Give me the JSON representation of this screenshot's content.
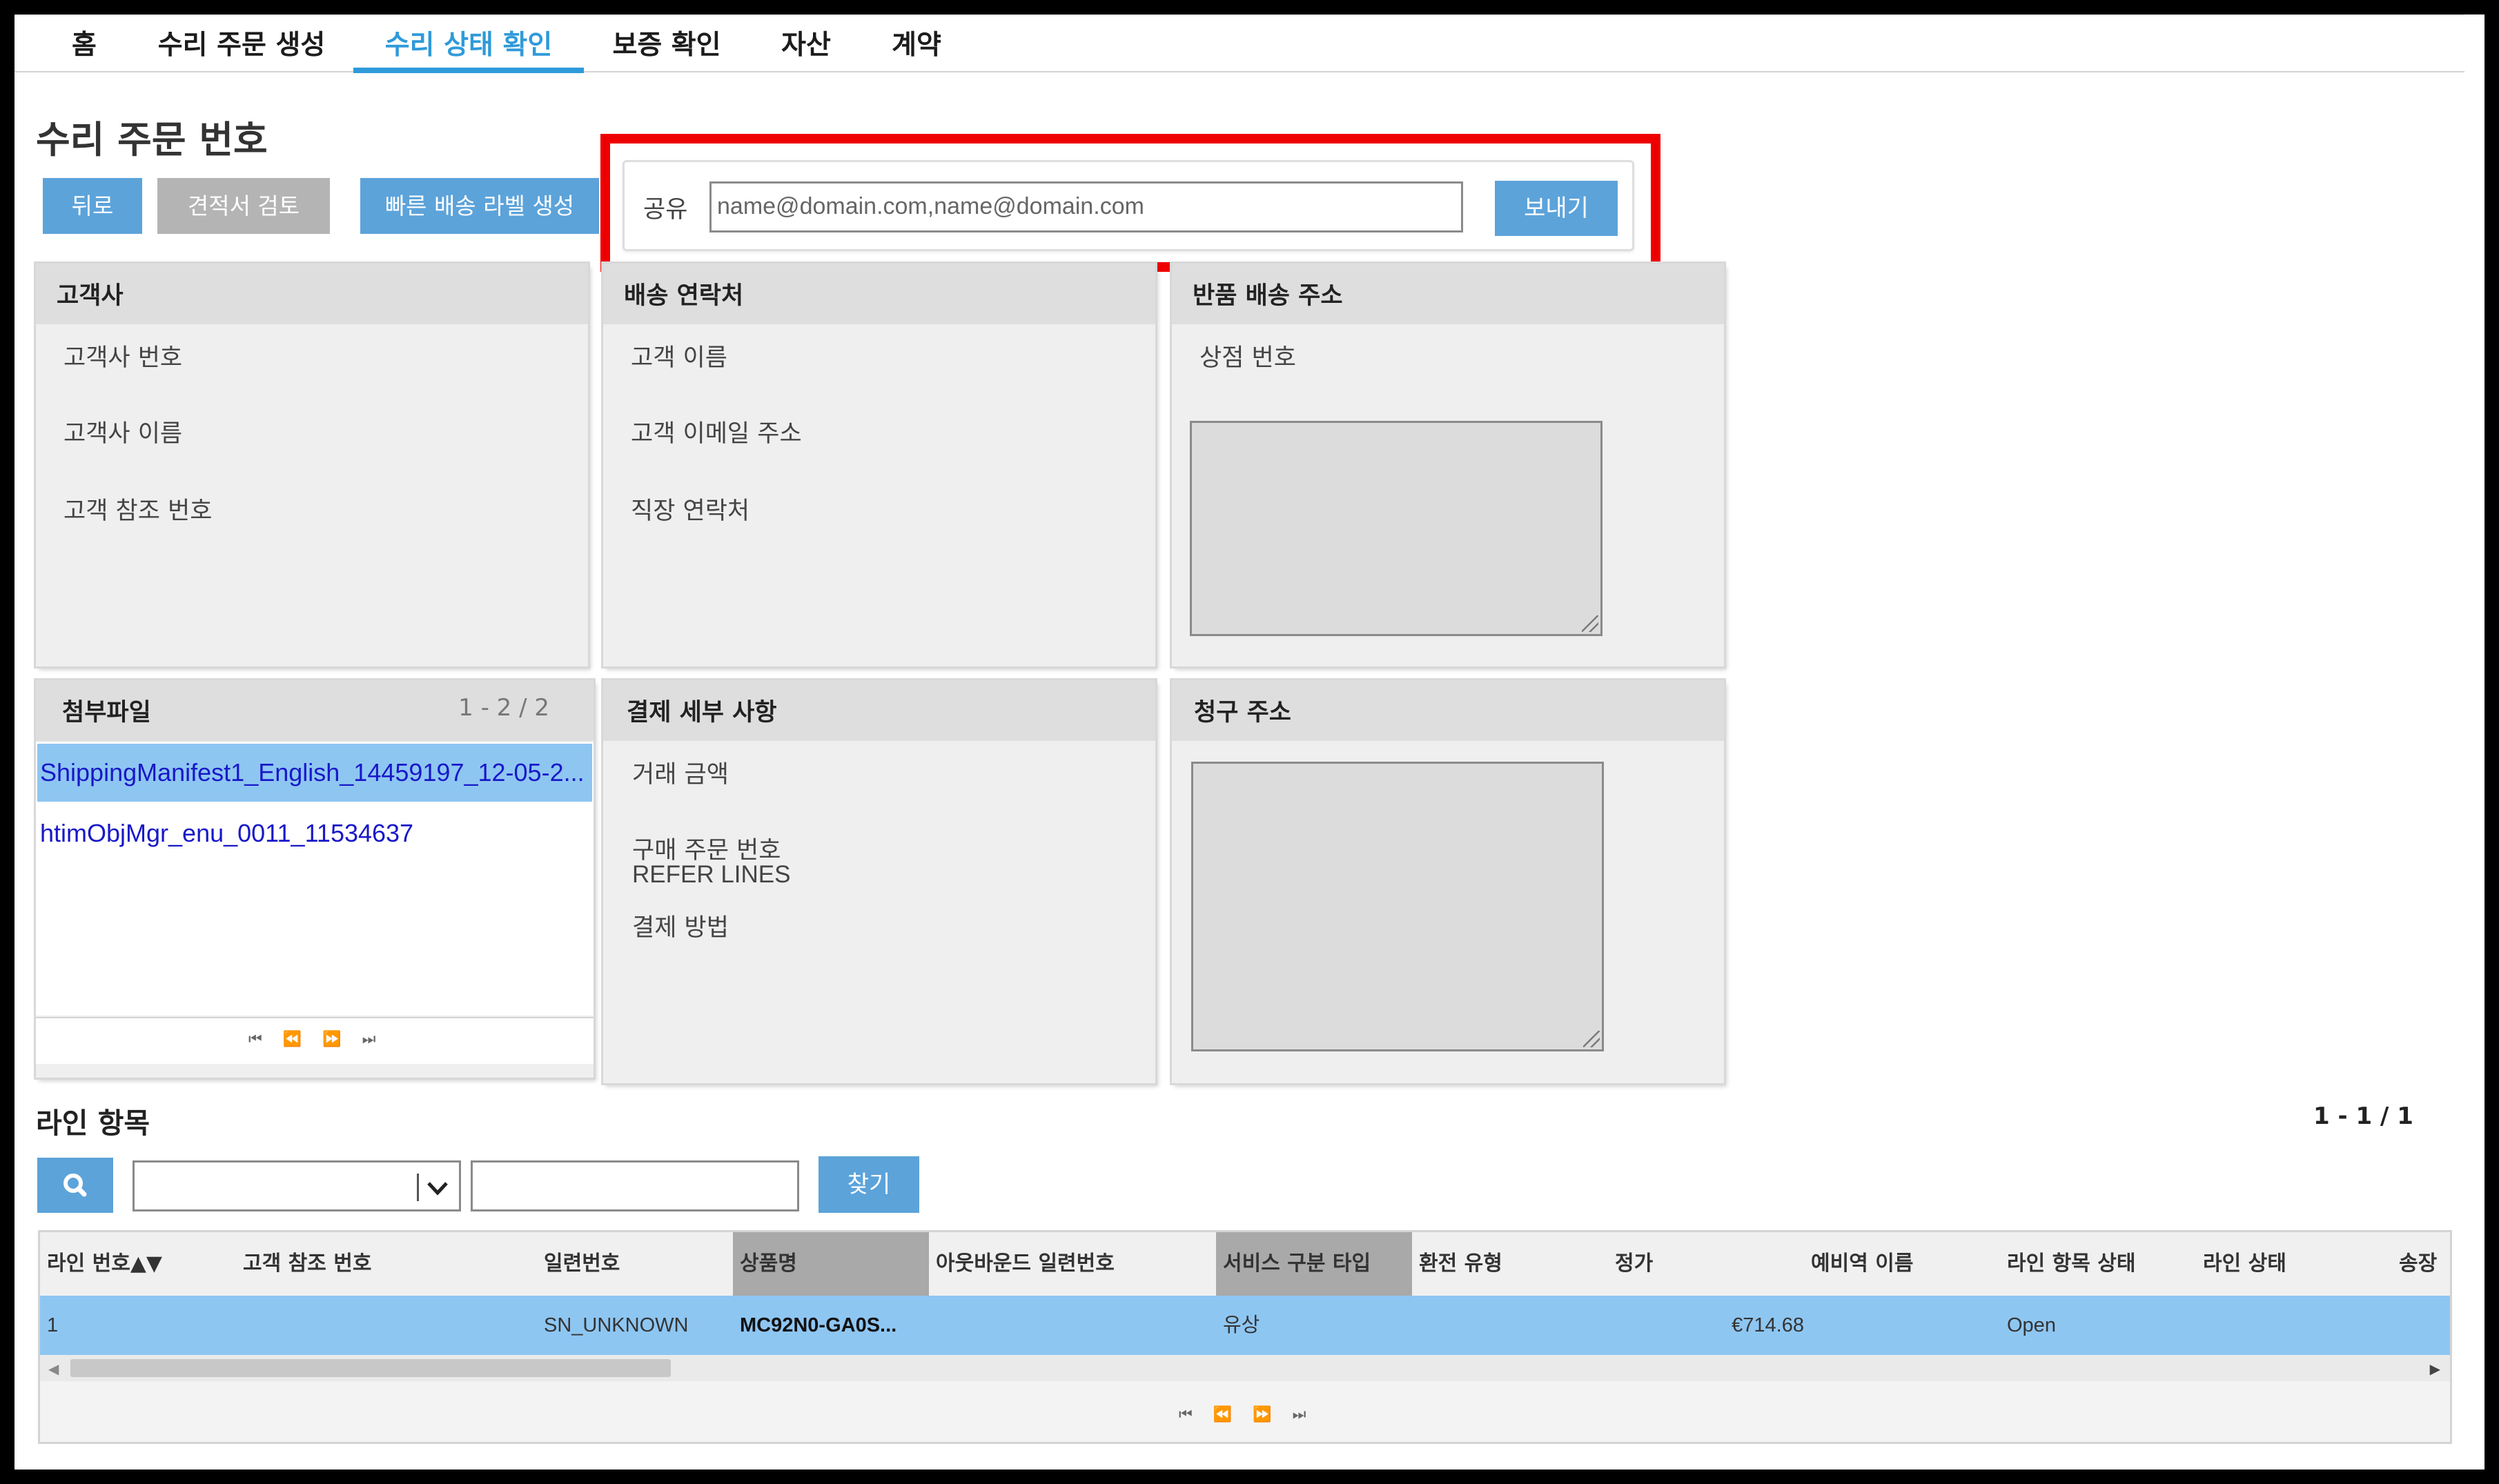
{
  "nav": {
    "tabs": [
      "홈",
      "수리 주문 생성",
      "수리 상태 확인",
      "보증 확인",
      "자산",
      "계약"
    ],
    "active_index": 2
  },
  "page_title": "수리 주문 번호",
  "actions": {
    "back": "뒤로",
    "quote_review": "견적서 검토",
    "quick_label": "빠른 배송 라벨 생성"
  },
  "share": {
    "label": "공유",
    "placeholder": "name@domain.com,name@domain.com",
    "send": "보내기"
  },
  "panels": {
    "customer": {
      "title": "고객사",
      "fields": [
        "고객사 번호",
        "고객사 이름",
        "고객 참조 번호"
      ]
    },
    "shipping_contact": {
      "title": "배송 연락처",
      "fields": [
        "고객 이름",
        "고객 이메일 주소",
        "직장 연락처"
      ]
    },
    "return_address": {
      "title": "반품 배송 주소",
      "fields": [
        "상점 번호"
      ]
    },
    "attachments": {
      "title": "첨부파일",
      "count": "1 - 2 / 2",
      "files": [
        "ShippingManifest1_English_14459197_12-05-2...",
        "htimObjMgr_enu_0011_11534637"
      ]
    },
    "payment": {
      "title": "결제 세부 사항",
      "fields": [
        "거래 금액",
        "구매 주문 번호",
        "REFER LINES",
        "결제 방법"
      ]
    },
    "billing": {
      "title": "청구 주소"
    }
  },
  "line_items": {
    "title": "라인 항목",
    "count": "1 - 1 / 1",
    "find": "찾기",
    "columns": [
      "라인 번호▲▼",
      "고객 참조 번호",
      "일련번호",
      "상품명",
      "아웃바운드 일련번호",
      "서비스 구분 타입",
      "환전 유형",
      "정가",
      "예비역 이름",
      "라인 항목 상태",
      "라인 상태",
      "송장"
    ],
    "rows": [
      [
        "1",
        "",
        "SN_UNKNOWN",
        "MC92N0-GA0S...",
        "",
        "유상",
        "",
        "€714.68",
        "",
        "Open",
        "",
        ""
      ]
    ]
  }
}
